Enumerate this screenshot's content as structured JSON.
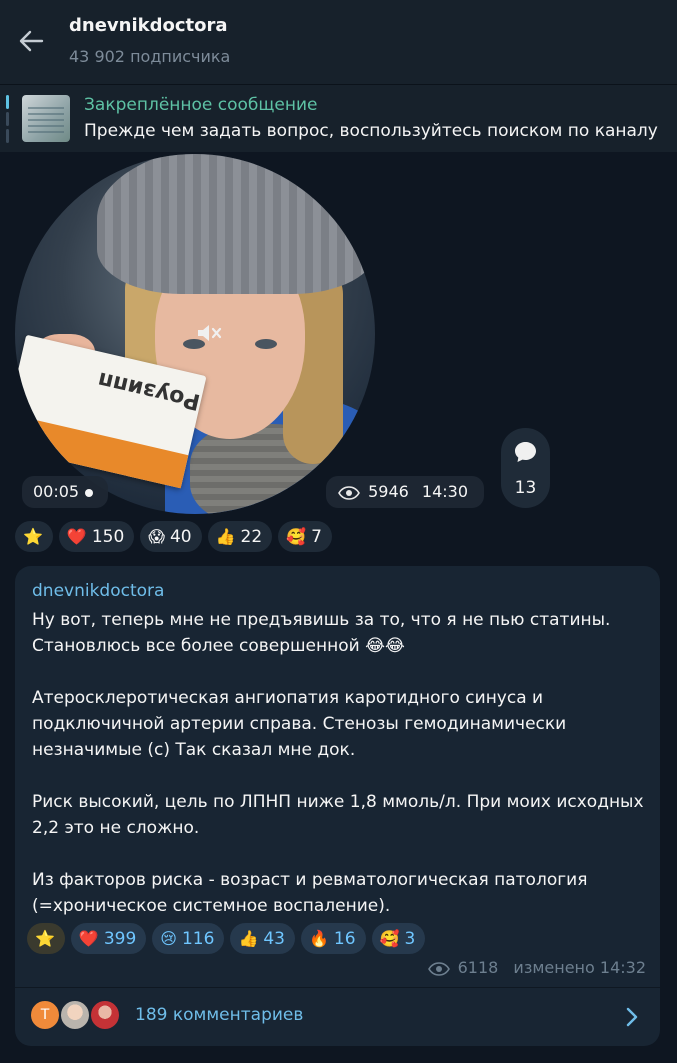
{
  "header": {
    "title": "dnevnikdoctora",
    "subscribers": "43 902 подписчика"
  },
  "pinned": {
    "label": "Закреплённое сообщение",
    "text": "Прежде чем задать вопрос, воспользуйтесь поиском по каналу"
  },
  "video_message": {
    "duration": "00:05",
    "views": "5946",
    "time": "14:30",
    "comments_count": "13",
    "package_text": "Роузипп",
    "reactions": [
      {
        "emoji": "⭐",
        "count": ""
      },
      {
        "emoji": "❤️",
        "count": "150"
      },
      {
        "emoji": "😱",
        "count": "40"
      },
      {
        "emoji": "👍",
        "count": "22"
      },
      {
        "emoji": "🥰",
        "count": "7"
      }
    ]
  },
  "text_message": {
    "author": "dnevnikdoctora",
    "paragraphs": [
      "Ну вот, теперь мне не предъявишь за то, что я не пью статины. Становлюсь все более совершенной 😂😂",
      "Атеросклеротическая ангиопатия каротидного синуса и подключичной артерии справа. Стенозы гемодинамически незначимые (с) Так сказал мне док.",
      "Риск высокий, цель по ЛПНП ниже 1,8 ммоль/л. При моих исходных 2,2 это не сложно.",
      "Из факторов риска - возраст и ревматологическая патология (=хроническое системное воспаление)."
    ],
    "reactions": [
      {
        "emoji": "⭐",
        "count": ""
      },
      {
        "emoji": "❤️",
        "count": "399"
      },
      {
        "emoji": "😢",
        "count": "116"
      },
      {
        "emoji": "👍",
        "count": "43"
      },
      {
        "emoji": "🔥",
        "count": "16"
      },
      {
        "emoji": "🥰",
        "count": "3"
      }
    ],
    "views": "6118",
    "edited_time": "изменено 14:32",
    "comments_label": "189 комментариев",
    "commenter_initial": "Т"
  },
  "colors": {
    "background": "#0e1621",
    "header": "#17212b",
    "bubble": "#182533",
    "accent": "#6fbde9",
    "pinned_accent": "#5ec2a5"
  }
}
